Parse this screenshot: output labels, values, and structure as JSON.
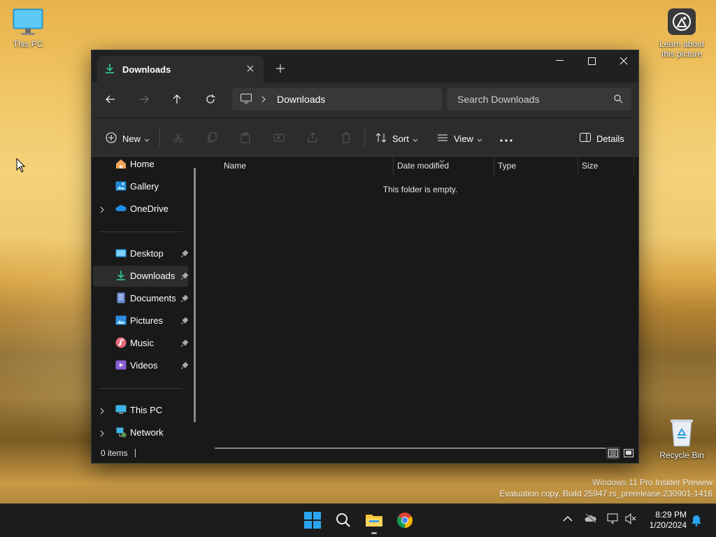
{
  "desktop": {
    "this_pc": "This PC",
    "learn_about": "Learn about this picture",
    "recycle_bin": "Recycle Bin",
    "watermark_line1": "Windows 11 Pro Insider Preview",
    "watermark_line2": "Evaluation copy. Build 25947.rs_prerelease.230901-1416"
  },
  "window": {
    "tab_title": "Downloads",
    "address_crumb": "Downloads",
    "search_placeholder": "Search Downloads",
    "toolbar": {
      "new_label": "New",
      "sort_label": "Sort",
      "view_label": "View",
      "details_label": "Details"
    },
    "sidebar": {
      "home": "Home",
      "gallery": "Gallery",
      "onedrive": "OneDrive",
      "desktop": "Desktop",
      "downloads": "Downloads",
      "documents": "Documents",
      "pictures": "Pictures",
      "music": "Music",
      "videos": "Videos",
      "this_pc": "This PC",
      "network": "Network"
    },
    "columns": {
      "name": "Name",
      "date_modified": "Date modified",
      "type": "Type",
      "size": "Size"
    },
    "empty_message": "This folder is empty.",
    "status": "0 items"
  },
  "taskbar": {
    "time": "8:29 PM",
    "date": "1/20/2024"
  },
  "colors": {
    "accent": "#0078d4",
    "window_bg": "#191919",
    "chrome_bg": "#2c2c2c",
    "downloads_icon": "#2fbf8f"
  }
}
